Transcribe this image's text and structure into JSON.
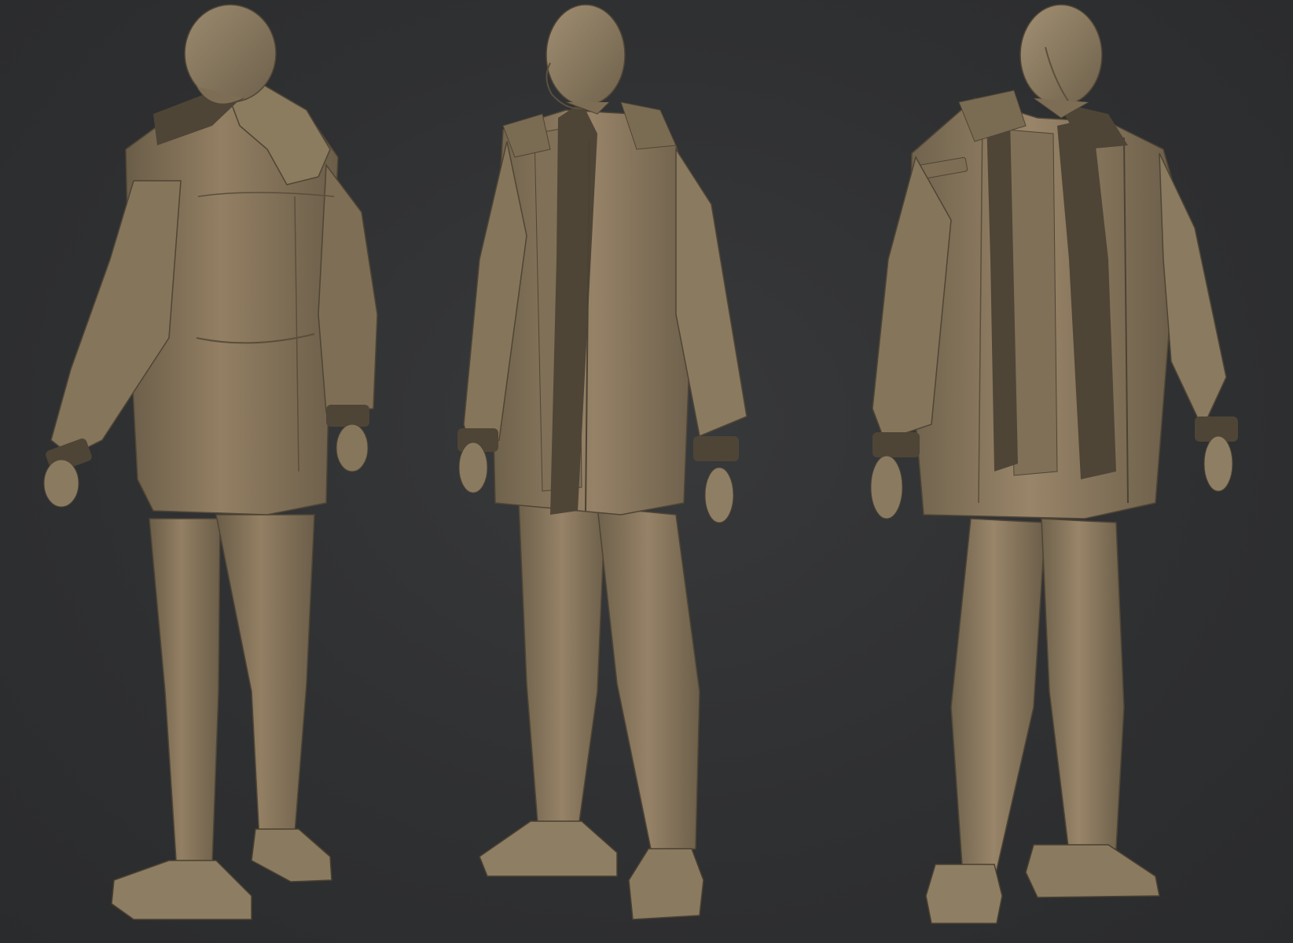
{
  "scene": {
    "background_color": "#2e2f31",
    "material_color": "#8a7a62",
    "material_shadow": "#5e523f",
    "material_highlight": "#a89677",
    "knit_color": "#4e4536"
  },
  "figures": [
    {
      "view": "back-three-quarter",
      "icon": "sculpt-figure-back"
    },
    {
      "view": "side-three-quarter",
      "icon": "sculpt-figure-side"
    },
    {
      "view": "front-three-quarter",
      "icon": "sculpt-figure-front"
    }
  ]
}
